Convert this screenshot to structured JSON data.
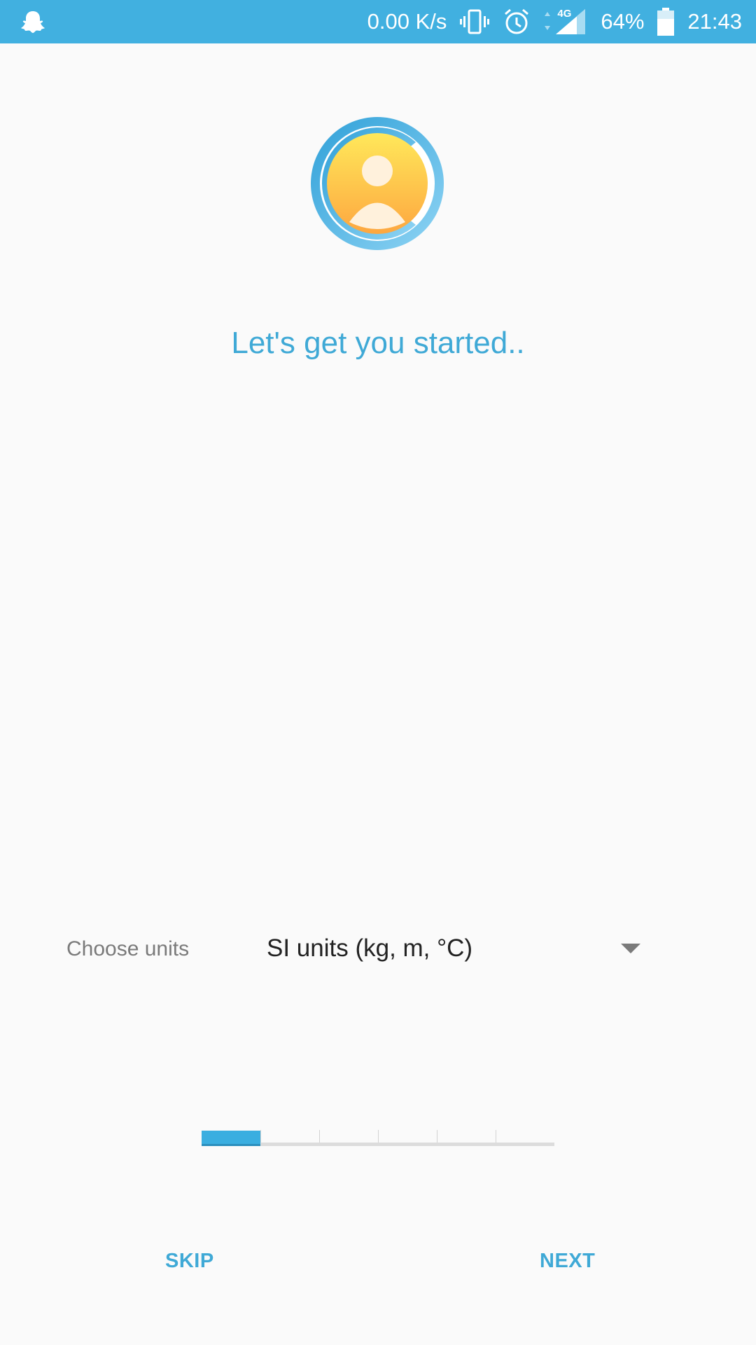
{
  "status_bar": {
    "network_speed": "0.00 K/s",
    "network_type": "4G",
    "battery": "64%",
    "time": "21:43",
    "icons": [
      "snapchat-ghost-icon",
      "vibrate-icon",
      "alarm-icon",
      "signal-icon",
      "battery-icon"
    ]
  },
  "onboarding": {
    "heading": "Let's get you started..",
    "units_label": "Choose units",
    "units_selected": "SI units (kg, m, °C)",
    "progress": {
      "current_step": 1,
      "total_steps": 6
    },
    "skip_label": "SKIP",
    "next_label": "NEXT"
  },
  "colors": {
    "status_bar": "#41b0e0",
    "accent": "#3fa9d6",
    "progress_fill": "#3aaee0"
  }
}
